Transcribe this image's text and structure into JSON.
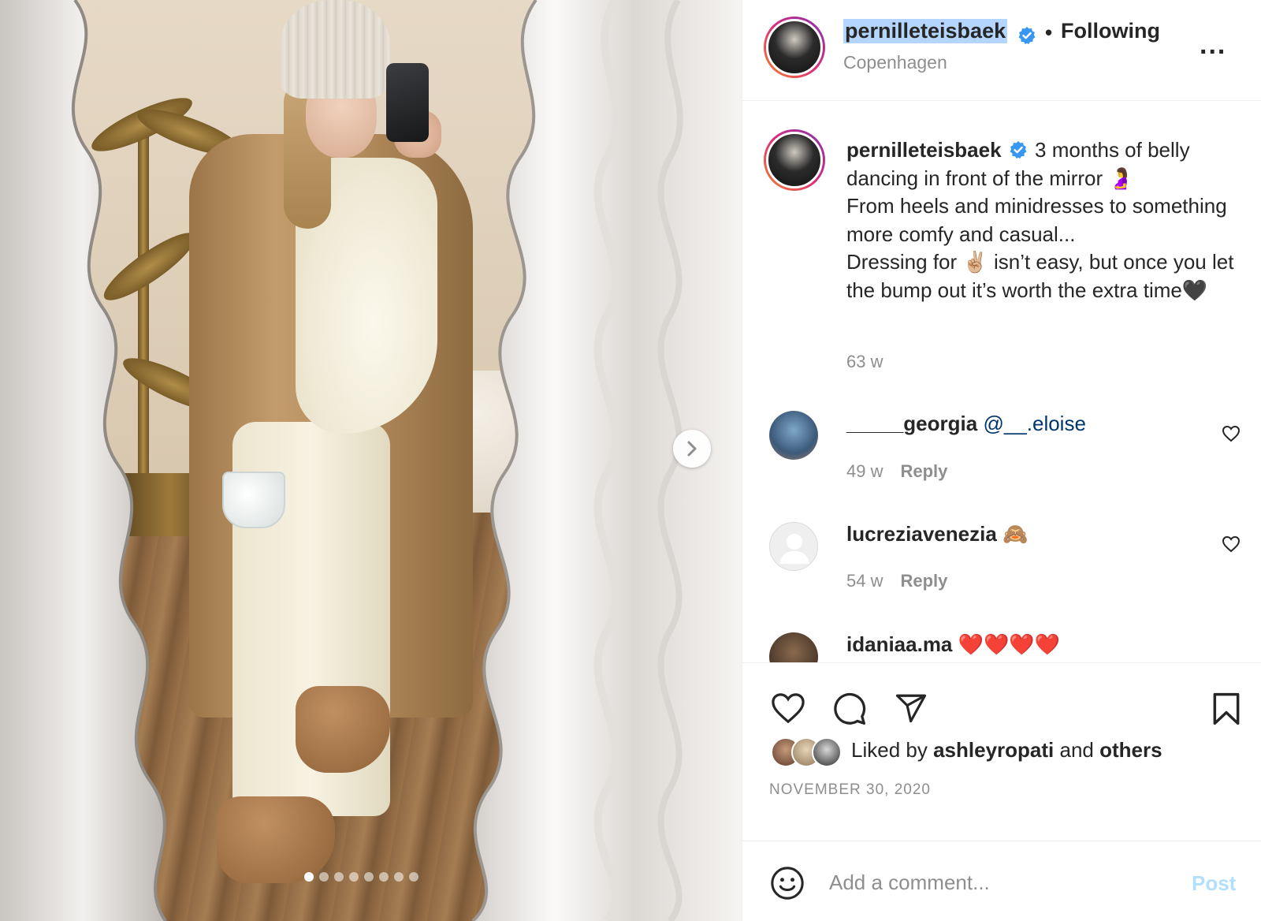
{
  "post": {
    "username": "pernilleteisbaek",
    "follow_status": "Following",
    "separator": "•",
    "location": "Copenhagen",
    "more_label": "...",
    "verified_color": "#3897f0"
  },
  "caption": {
    "username": "pernilleteisbaek",
    "text_line1": "3 months of belly dancing in front of the mirror 🤰",
    "text_line2": "From heels and minidresses to something more comfy and casual...",
    "text_line3": "Dressing for ✌🏼 isn’t easy, but once you let the bump out it’s worth the extra time🖤",
    "age": "63 w"
  },
  "comments": [
    {
      "username": "_____georgia",
      "mention": "@__.eloise",
      "text": "",
      "age": "49 w",
      "reply": "Reply"
    },
    {
      "username": "lucreziavenezia",
      "mention": "",
      "text": "🙈",
      "age": "54 w",
      "reply": "Reply"
    },
    {
      "username": "idaniaa.ma",
      "mention": "",
      "text": "❤️❤️❤️❤️",
      "age": "",
      "reply": ""
    }
  ],
  "likes": {
    "prefix": "Liked by",
    "user": "ashleyropati",
    "conj": "and",
    "others": "others"
  },
  "date": "NOVEMBER 30, 2020",
  "add_comment": {
    "placeholder": "Add a comment...",
    "post_label": "Post",
    "post_color": "#b2dffc"
  },
  "carousel": {
    "total": 8,
    "active": 1
  },
  "icons": [
    "heart-icon",
    "comment-icon",
    "share-icon",
    "bookmark-icon",
    "emoji-icon",
    "chevron-right-icon",
    "verified-badge-icon",
    "more-icon"
  ]
}
